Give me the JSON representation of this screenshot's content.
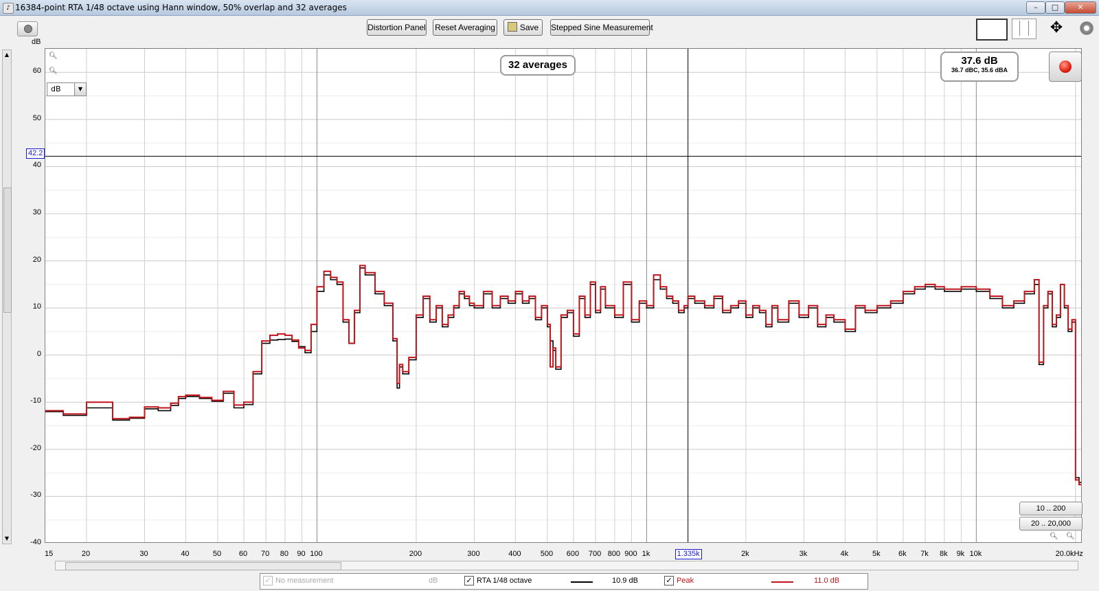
{
  "window": {
    "title": "16384-point RTA 1/48 octave using Hann window, 50% overlap and 32 averages",
    "minimize": "–",
    "maximize": "□",
    "close": "✕"
  },
  "toolbar": {
    "distortion_panel": "Distortion Panel",
    "reset_averaging": "Reset Averaging",
    "save": "Save",
    "stepped_sine": "Stepped Sine Measurement",
    "icons": [
      "camera-icon",
      "single-graph-icon",
      "split-graph-icon",
      "fit-axes-icon",
      "settings-gear-icon"
    ]
  },
  "chart": {
    "y_unit": "dB",
    "unit_select": "dB",
    "averages_badge": "32 averages",
    "level_main": "37.6 dB",
    "level_sub": "36.7 dBC, 35.6 dBA",
    "cursor_y": "42.2",
    "cursor_x": "1.335k",
    "range_btn_1": "10 .. 200",
    "range_btn_2": "20 .. 20,000"
  },
  "chart_data": {
    "type": "line",
    "xscale": "log",
    "xlim": [
      15,
      21000
    ],
    "ylim": [
      -40,
      65
    ],
    "yticks": [
      60,
      50,
      40,
      30,
      20,
      10,
      0,
      -10,
      -20,
      -30,
      -40
    ],
    "ytick_labels": [
      "60",
      "50",
      "40",
      "30",
      "20",
      "10",
      "0",
      "-10",
      "-20",
      "-30",
      "-40"
    ],
    "xticks": [
      15,
      20,
      30,
      40,
      50,
      60,
      70,
      80,
      90,
      100,
      200,
      300,
      400,
      500,
      600,
      700,
      800,
      900,
      1000,
      2000,
      3000,
      4000,
      5000,
      6000,
      7000,
      8000,
      9000,
      10000,
      20000
    ],
    "xtick_labels": [
      "15",
      "20",
      "30",
      "40",
      "50",
      "60",
      "70",
      "80",
      "90",
      "100",
      "200",
      "300",
      "400",
      "500",
      "600",
      "700",
      "800",
      "900",
      "1k",
      "2k",
      "3k",
      "4k",
      "5k",
      "6k",
      "7k",
      "8k",
      "9k",
      "10k",
      "20.0kHz"
    ],
    "cursor": {
      "x": 1335,
      "y": 42.2
    },
    "grid": true,
    "series": [
      {
        "name": "RTA 1/48 octave",
        "color": "#000000",
        "x": [
          15,
          17,
          18,
          19,
          20,
          22,
          24,
          27,
          30,
          33,
          36,
          38,
          40,
          44,
          48,
          52,
          56,
          60,
          64,
          68,
          72,
          76,
          80,
          84,
          88,
          92,
          96,
          100,
          105,
          110,
          115,
          120,
          125,
          130,
          135,
          140,
          150,
          160,
          170,
          175,
          178,
          182,
          190,
          200,
          210,
          220,
          230,
          240,
          250,
          260,
          270,
          280,
          290,
          300,
          320,
          340,
          360,
          380,
          400,
          420,
          440,
          460,
          480,
          500,
          510,
          520,
          530,
          550,
          575,
          600,
          625,
          650,
          675,
          700,
          725,
          750,
          800,
          850,
          900,
          950,
          1000,
          1050,
          1100,
          1150,
          1200,
          1250,
          1300,
          1335,
          1400,
          1500,
          1600,
          1700,
          1800,
          1900,
          2000,
          2100,
          2200,
          2300,
          2400,
          2500,
          2700,
          2900,
          3100,
          3300,
          3500,
          3700,
          4000,
          4300,
          4600,
          5000,
          5500,
          6000,
          6500,
          7000,
          7500,
          8000,
          9000,
          10000,
          11000,
          12000,
          13000,
          14000,
          15000,
          15500,
          16000,
          16500,
          17000,
          17500,
          18000,
          18500,
          19000,
          19500,
          20000,
          20500,
          21000
        ],
        "y": [
          -12,
          -12.8,
          -12.8,
          -12.8,
          -11.2,
          -11.2,
          -13.8,
          -13.4,
          -11.4,
          -11.8,
          -10.7,
          -9.2,
          -8.8,
          -9.2,
          -9.8,
          -8.1,
          -11.2,
          -10.5,
          -4,
          2.5,
          3.2,
          3.3,
          3.4,
          2.9,
          1.8,
          0.5,
          5,
          13.5,
          17,
          16,
          15,
          7,
          2.5,
          9,
          18.5,
          17,
          13,
          10.5,
          3,
          -7,
          -2.5,
          -4,
          -1,
          8,
          12,
          7,
          10,
          6,
          8,
          10,
          13,
          12,
          10.5,
          10,
          13,
          10,
          12,
          11,
          13,
          11,
          12,
          7.5,
          10,
          6,
          3,
          1,
          -3,
          8,
          9,
          4,
          12,
          8,
          15,
          9,
          14,
          10,
          8,
          15,
          7,
          11,
          10,
          16,
          14,
          12,
          11,
          9,
          10,
          12,
          11,
          10,
          12,
          9,
          10,
          11,
          8,
          10,
          9,
          6,
          10,
          7,
          11,
          8,
          10,
          6,
          8,
          7,
          5,
          10,
          9,
          10,
          11,
          13,
          14,
          14.5,
          14,
          13.5,
          14,
          13.5,
          12,
          10,
          11,
          13,
          15,
          -2,
          10,
          13,
          6,
          8,
          15,
          10,
          5,
          7,
          -26,
          -27,
          -28
        ]
      },
      {
        "name": "Peak",
        "color": "#c0141a",
        "x": [
          15,
          17,
          18,
          19,
          20,
          22,
          24,
          27,
          30,
          33,
          36,
          38,
          40,
          44,
          48,
          52,
          56,
          60,
          64,
          68,
          72,
          76,
          80,
          84,
          88,
          92,
          96,
          100,
          105,
          110,
          115,
          120,
          125,
          130,
          135,
          140,
          150,
          160,
          170,
          175,
          178,
          182,
          190,
          200,
          210,
          220,
          230,
          240,
          250,
          260,
          270,
          280,
          290,
          300,
          320,
          340,
          360,
          380,
          400,
          420,
          440,
          460,
          480,
          500,
          510,
          520,
          530,
          550,
          575,
          600,
          625,
          650,
          675,
          700,
          725,
          750,
          800,
          850,
          900,
          950,
          1000,
          1050,
          1100,
          1150,
          1200,
          1250,
          1300,
          1335,
          1400,
          1500,
          1600,
          1700,
          1800,
          1900,
          2000,
          2100,
          2200,
          2300,
          2400,
          2500,
          2700,
          2900,
          3100,
          3300,
          3500,
          3700,
          4000,
          4300,
          4600,
          5000,
          5500,
          6000,
          6500,
          7000,
          7500,
          8000,
          9000,
          10000,
          11000,
          12000,
          13000,
          14000,
          15000,
          15500,
          16000,
          16500,
          17000,
          17500,
          18000,
          18500,
          19000,
          19500,
          20000,
          20500,
          21000
        ],
        "y": [
          -11.8,
          -12.5,
          -12.5,
          -12.5,
          -10,
          -10,
          -13.5,
          -13.2,
          -11,
          -11.2,
          -10.2,
          -8.8,
          -8.5,
          -9,
          -9.6,
          -7.7,
          -10.6,
          -10,
          -3.5,
          3,
          4.2,
          4.5,
          4.2,
          3.2,
          1.5,
          1,
          6.5,
          14.5,
          17.8,
          16.5,
          15.5,
          7.5,
          2.5,
          9.5,
          19,
          17.5,
          13.5,
          11,
          3.5,
          -6,
          -2,
          -3.5,
          -0.5,
          8.5,
          12.5,
          7.5,
          10.5,
          6.5,
          8.5,
          10.5,
          13.5,
          12.5,
          11,
          10.5,
          13.5,
          10.5,
          12.5,
          11.5,
          13.5,
          11.5,
          12.5,
          8,
          10.5,
          6.5,
          -2.5,
          1.5,
          -2.5,
          8.5,
          9.5,
          4.5,
          12.5,
          8.5,
          15.5,
          9.5,
          14.5,
          10.5,
          8.5,
          15.5,
          7.5,
          11.5,
          10.5,
          17,
          14.5,
          12.5,
          11.5,
          9.5,
          10.5,
          12.5,
          11.5,
          10.5,
          12.5,
          9.5,
          10.5,
          11.5,
          8.5,
          10.5,
          9.5,
          6.5,
          10.5,
          7.5,
          11.5,
          8.5,
          10.5,
          6.5,
          8.5,
          7.5,
          5.5,
          10.5,
          9.5,
          10.5,
          11.5,
          13.5,
          14.5,
          15,
          14.5,
          14,
          14.5,
          14,
          12.5,
          10.5,
          11.5,
          13.5,
          16,
          -1.5,
          10.5,
          13.5,
          6.5,
          8.5,
          15,
          10.5,
          5.5,
          7.5,
          -26.5,
          -27.5,
          -28
        ]
      }
    ]
  },
  "legend": {
    "no_measurement": "No measurement",
    "no_measurement_value": "dB",
    "rta_name": "RTA 1/48 octave",
    "rta_value": "10.9 dB",
    "peak_name": "Peak",
    "peak_value": "11.0 dB",
    "checkmark": "✓"
  }
}
